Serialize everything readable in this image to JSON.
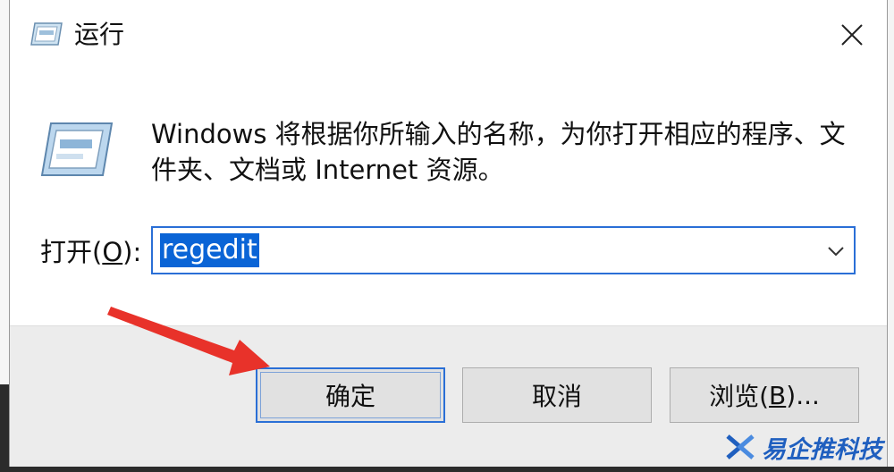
{
  "window": {
    "title": "运行",
    "close_glyph": "✕"
  },
  "content": {
    "description": "Windows 将根据你所输入的名称，为你打开相应的程序、文件夹、文档或 Internet 资源。",
    "open_label_prefix": "打开(",
    "open_label_key": "O",
    "open_label_suffix": "):",
    "command_value": "regedit"
  },
  "buttons": {
    "ok": "确定",
    "cancel": "取消",
    "browse_prefix": "浏览(",
    "browse_key": "B",
    "browse_suffix": ")..."
  },
  "watermark": {
    "text": "易企推科技"
  },
  "colors": {
    "focus": "#2a6fd6",
    "selection": "#0a64d6",
    "arrow": "#e8322a",
    "watermark": "#1f5fbf"
  }
}
